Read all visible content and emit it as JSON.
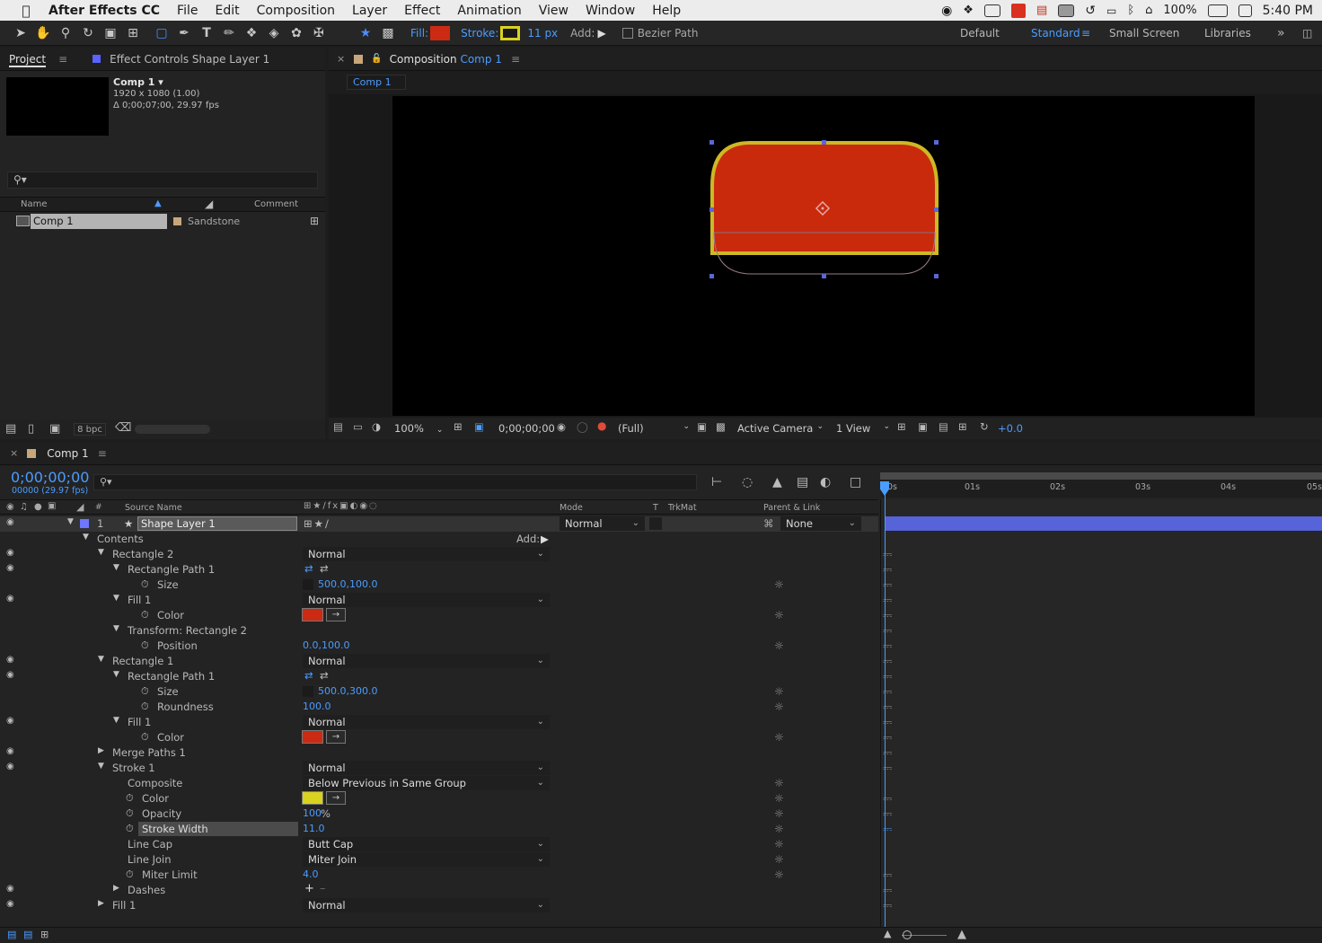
{
  "menubar": {
    "app_name": "After Effects CC",
    "items": [
      "File",
      "Edit",
      "Composition",
      "Layer",
      "Effect",
      "Animation",
      "View",
      "Window",
      "Help"
    ],
    "battery": "100%",
    "clock": "5:40 PM"
  },
  "toolbar": {
    "fill_label": "Fill:",
    "fill_color": "#cc2a12",
    "stroke_label": "Stroke:",
    "stroke_color": "#d9d21e",
    "stroke_width": "11 px",
    "add_label": "Add:",
    "bezier_label": "Bezier Path",
    "workspaces": [
      "Default",
      "Standard",
      "Small Screen",
      "Libraries"
    ],
    "active_workspace": "Standard"
  },
  "project": {
    "tab_project": "Project",
    "tab_effect_controls": "Effect Controls Shape Layer 1",
    "comp_name": "Comp 1",
    "comp_dims": "1920 x 1080 (1.00)",
    "comp_duration": "Δ 0;00;07;00, 29.97 fps",
    "col_name": "Name",
    "col_comment": "Comment",
    "item_name": "Comp 1",
    "item_label": "Sandstone",
    "bpc": "8 bpc"
  },
  "composition": {
    "tab_prefix": "Composition",
    "tab_name": "Comp 1",
    "viewer_tab": "Comp 1",
    "shape_fill": "#c92a0c",
    "shape_stroke": "#cdb825",
    "zoom": "100%",
    "timecode": "0;00;00;00",
    "resolution": "(Full)",
    "camera": "Active Camera",
    "views": "1 View",
    "exposure": "+0.0"
  },
  "timeline": {
    "tab_name": "Comp 1",
    "timecode": "0;00;00;00",
    "fps_info": "00000 (29.97 fps)",
    "col_source": "Source Name",
    "col_mode": "Mode",
    "col_t": "T",
    "col_trkmat": "TrkMat",
    "col_parent": "Parent & Link",
    "layer_num": "1",
    "layer_name": "Shape Layer 1",
    "layer_mode": "Normal",
    "layer_parent": "None",
    "ruler": [
      "0s",
      "01s",
      "02s",
      "03s",
      "04s",
      "05s"
    ],
    "props": {
      "contents": "Contents",
      "add": "Add:",
      "rect2": "Rectangle 2",
      "rect2_mode": "Normal",
      "rect2_path": "Rectangle Path 1",
      "size": "Size",
      "rect2_size": "500.0,100.0",
      "fill1": "Fill 1",
      "fill1_mode": "Normal",
      "color": "Color",
      "transform_rect2": "Transform: Rectangle 2",
      "position": "Position",
      "position_val": "0.0,100.0",
      "rect1": "Rectangle 1",
      "rect1_mode": "Normal",
      "rect1_path": "Rectangle Path 1",
      "rect1_size": "500.0,300.0",
      "roundness": "Roundness",
      "roundness_val": "100.0",
      "fill1b": "Fill 1",
      "fill1b_mode": "Normal",
      "merge": "Merge Paths 1",
      "stroke": "Stroke 1",
      "stroke_mode": "Normal",
      "composite": "Composite",
      "composite_val": "Below Previous in Same Group",
      "opacity": "Opacity",
      "opacity_val": "100",
      "opacity_unit": "%",
      "stroke_width": "Stroke Width",
      "stroke_width_val": "11.0",
      "line_cap": "Line Cap",
      "line_cap_val": "Butt Cap",
      "line_join": "Line Join",
      "line_join_val": "Miter Join",
      "miter": "Miter Limit",
      "miter_val": "4.0",
      "dashes": "Dashes",
      "fill_last": "Fill 1",
      "fill_last_mode": "Normal"
    },
    "fill_color": "#cc2a12",
    "stroke_color": "#d9d21e"
  }
}
